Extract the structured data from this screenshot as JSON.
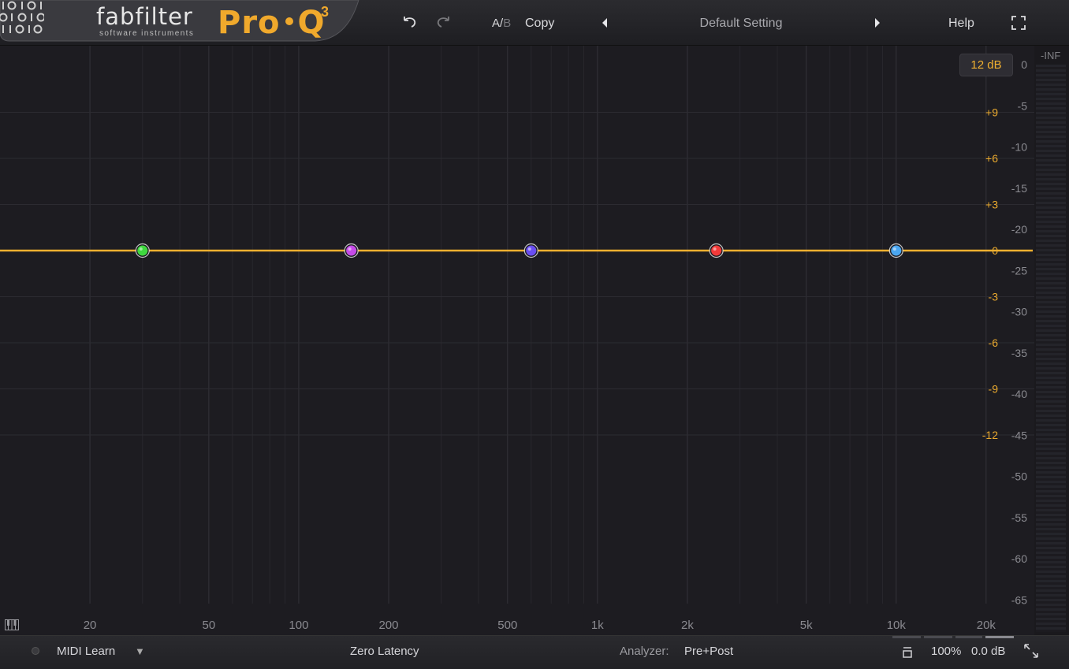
{
  "header": {
    "brand": "fabfilter",
    "brand_sub": "software instruments",
    "product": "Pro",
    "product_letter": "Q",
    "product_version": "3",
    "ab_a": "A/",
    "ab_b": "B",
    "copy_label": "Copy",
    "preset_name": "Default Setting",
    "help_label": "Help"
  },
  "display": {
    "range_label": "12 dB",
    "gain_scale_labels": [
      "+9",
      "+6",
      "+3",
      "0",
      "-3",
      "-6",
      "-9",
      "-12"
    ],
    "gain_scale_values": [
      9,
      6,
      3,
      0,
      -3,
      -6,
      -9,
      -12
    ],
    "analyzer_scale_labels": [
      "0",
      "-5",
      "-10",
      "-15",
      "-20",
      "-25",
      "-30",
      "-35",
      "-40",
      "-45",
      "-50",
      "-55",
      "-60",
      "-65"
    ],
    "analyzer_scale_values": [
      0,
      -5,
      -10,
      -15,
      -20,
      -25,
      -30,
      -35,
      -40,
      -45,
      -50,
      -55,
      -60,
      -65
    ],
    "freq_labels": [
      "20",
      "50",
      "100",
      "200",
      "500",
      "1k",
      "2k",
      "5k",
      "10k",
      "20k"
    ],
    "freq_values": [
      20,
      50,
      100,
      200,
      500,
      1000,
      2000,
      5000,
      10000,
      20000
    ],
    "curve_color": "#f0b030",
    "bands": [
      {
        "freq_hz": 30,
        "gain_db": 0,
        "color": "#3fd93f"
      },
      {
        "freq_hz": 150,
        "gain_db": 0,
        "color": "#c64be8"
      },
      {
        "freq_hz": 600,
        "gain_db": 0,
        "color": "#6a4ef2"
      },
      {
        "freq_hz": 2500,
        "gain_db": 0,
        "color": "#f23a3a"
      },
      {
        "freq_hz": 10000,
        "gain_db": 0,
        "color": "#4aa6f0"
      }
    ]
  },
  "meter": {
    "top_label": "-INF"
  },
  "footer": {
    "midi_learn_label": "MIDI Learn",
    "latency_label": "Zero Latency",
    "analyzer_label": "Analyzer:",
    "analyzer_value": "Pre+Post",
    "zoom_label": "100%",
    "output_gain_label": "0.0 dB"
  },
  "icons": [
    "undo-icon",
    "redo-icon",
    "prev-preset-icon",
    "next-preset-icon",
    "fullscreen-icon",
    "piano-icon",
    "chevron-down-icon",
    "compact-icon",
    "resize-icon"
  ]
}
